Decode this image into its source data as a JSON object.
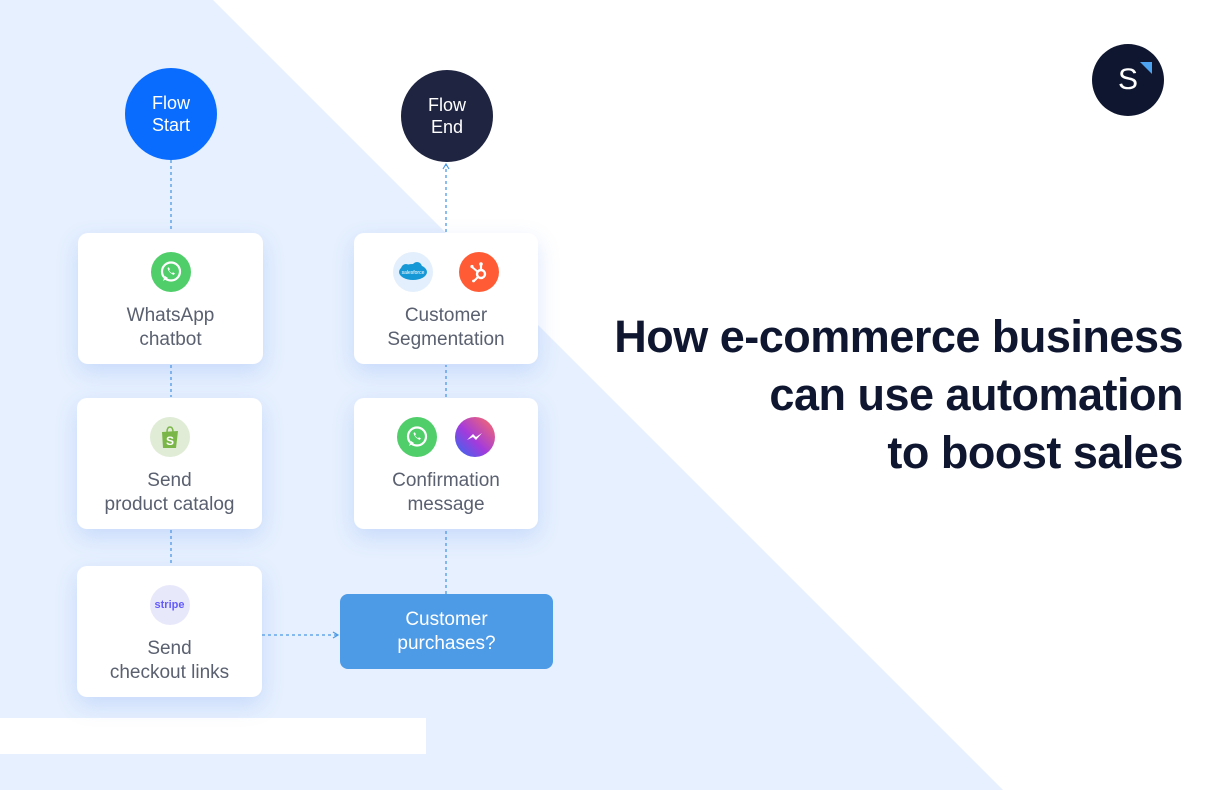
{
  "colors": {
    "background_shape": "#e6f0fe",
    "flow_start": "#0a6cff",
    "flow_end": "#1f2440",
    "decision": "#4d9ae6",
    "connector": "#4d9ae6",
    "headline": "#0f1730",
    "card_text": "#5a6070"
  },
  "logo": {
    "letter": "S",
    "icon": "brand-logo-icon"
  },
  "headline": {
    "lines": [
      "How e-commerce business",
      "can use automation",
      "to boost sales"
    ]
  },
  "flow": {
    "start": {
      "lines": [
        "Flow",
        "Start"
      ]
    },
    "end": {
      "lines": [
        "Flow",
        "End"
      ]
    },
    "left_column": [
      {
        "id": "whatsapp-chatbot",
        "icons": [
          "whatsapp-icon"
        ],
        "lines": [
          "WhatsApp",
          "chatbot"
        ]
      },
      {
        "id": "send-product-catalog",
        "icons": [
          "shopify-icon"
        ],
        "lines": [
          "Send",
          "product catalog"
        ]
      },
      {
        "id": "send-checkout-links",
        "icons": [
          "stripe-icon"
        ],
        "icon_text": "stripe",
        "lines": [
          "Send",
          "checkout links"
        ]
      }
    ],
    "decision": {
      "lines": [
        "Customer",
        "purchases?"
      ]
    },
    "right_column": [
      {
        "id": "confirmation-message",
        "icons": [
          "whatsapp-icon",
          "messenger-icon"
        ],
        "lines": [
          "Confirmation",
          "message"
        ]
      },
      {
        "id": "customer-segmentation",
        "icons": [
          "salesforce-icon",
          "hubspot-icon"
        ],
        "icon_text": "salesforce",
        "lines": [
          "Customer",
          "Segmentation"
        ]
      }
    ]
  }
}
